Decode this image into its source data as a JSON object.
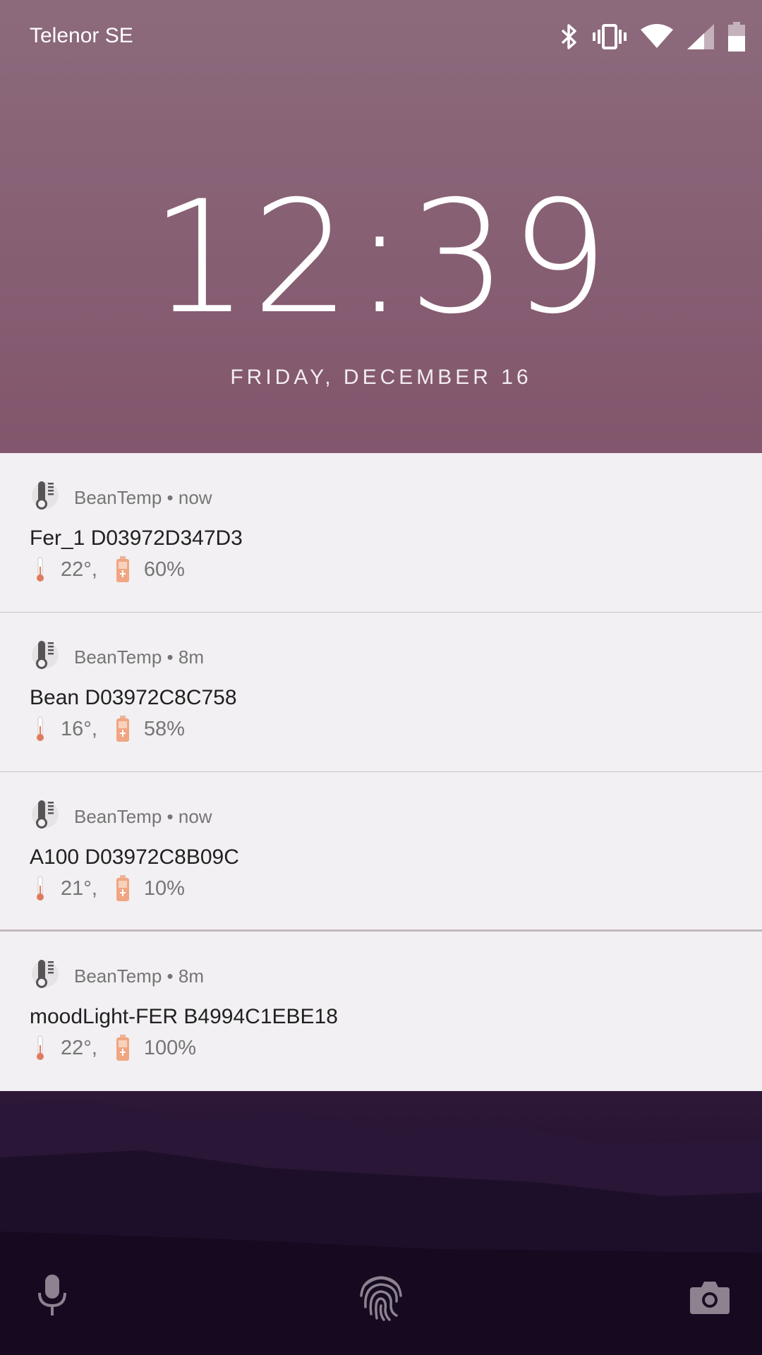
{
  "status_bar": {
    "carrier": "Telenor SE",
    "icons": [
      "bluetooth-icon",
      "vibrate-icon",
      "wifi-icon",
      "cell-signal-icon",
      "battery-icon"
    ]
  },
  "clock": {
    "time": "12:39",
    "date": "FRIDAY, DECEMBER 16"
  },
  "notifications": [
    {
      "app": "BeanTemp",
      "time": "now",
      "title": "Fer_1 D03972D347D3",
      "temperature": "22°,",
      "battery": "60%"
    },
    {
      "app": "BeanTemp",
      "time": "8m",
      "title": "Bean D03972C8C758",
      "temperature": "16°,",
      "battery": "58%"
    },
    {
      "app": "BeanTemp",
      "time": "now",
      "title": "A100 D03972C8B09C",
      "temperature": "21°,",
      "battery": "10%"
    },
    {
      "app": "BeanTemp",
      "time": "8m",
      "title": "moodLight-FER B4994C1EBE18",
      "temperature": "22°,",
      "battery": "100%"
    }
  ],
  "separator": " • ",
  "bottom_actions": [
    "mic-icon",
    "fingerprint-icon",
    "camera-icon"
  ],
  "colors": {
    "notification_bg": "#f2f0f2",
    "header_text": "#757575",
    "title_text": "#212121",
    "wallpaper_top": "#8c6a7c",
    "wallpaper_bottom": "#150a1f"
  }
}
